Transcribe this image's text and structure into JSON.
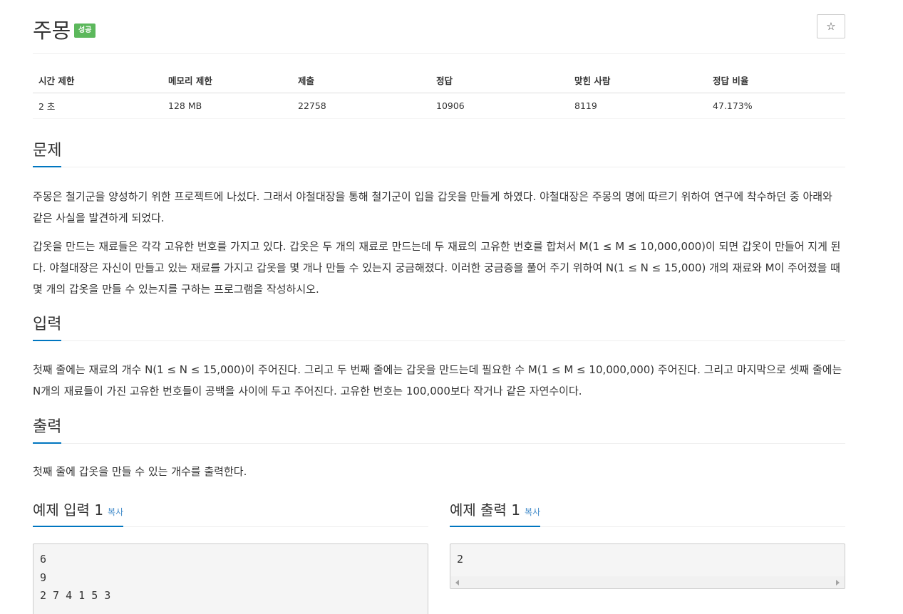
{
  "problem": {
    "title": "주몽",
    "badge": "성공",
    "star_icon": "☆"
  },
  "info_table": {
    "headers": [
      "시간 제한",
      "메모리 제한",
      "제출",
      "정답",
      "맞힌 사람",
      "정답 비율"
    ],
    "values": [
      "2 초",
      "128 MB",
      "22758",
      "10906",
      "8119",
      "47.173%"
    ]
  },
  "sections": {
    "description": {
      "heading": "문제",
      "paragraphs": [
        "주몽은 철기군을 양성하기 위한 프로젝트에 나섰다. 그래서 야철대장을 통해 철기군이 입을 갑옷을 만들게 하였다. 야철대장은 주몽의 명에 따르기 위하여 연구에 착수하던 중 아래와 같은 사실을 발견하게 되었다.",
        "갑옷을 만드는 재료들은 각각 고유한 번호를 가지고 있다. 갑옷은 두 개의 재료로 만드는데 두 재료의 고유한 번호를 합쳐서 M(1 ≤ M ≤ 10,000,000)이 되면 갑옷이 만들어 지게 된다. 야철대장은 자신이 만들고 있는 재료를 가지고 갑옷을 몇 개나 만들 수 있는지 궁금해졌다. 이러한 궁금증을 풀어 주기 위하여 N(1 ≤ N ≤ 15,000) 개의 재료와 M이 주어졌을 때 몇 개의 갑옷을 만들 수 있는지를 구하는 프로그램을 작성하시오."
      ]
    },
    "input": {
      "heading": "입력",
      "text": "첫째 줄에는 재료의 개수 N(1 ≤ N ≤ 15,000)이 주어진다. 그리고 두 번째 줄에는 갑옷을 만드는데 필요한 수 M(1 ≤ M ≤ 10,000,000) 주어진다. 그리고 마지막으로 셋째 줄에는 N개의 재료들이 가진 고유한 번호들이 공백을 사이에 두고 주어진다. 고유한 번호는 100,000보다 작거나 같은 자연수이다."
    },
    "output": {
      "heading": "출력",
      "text": "첫째 줄에 갑옷을 만들 수 있는 개수를 출력한다."
    }
  },
  "examples": {
    "input_1": {
      "heading": "예제 입력 1",
      "copy_label": "복사",
      "content": "6\n9\n2 7 4 1 5 3"
    },
    "output_1": {
      "heading": "예제 출력 1",
      "copy_label": "복사",
      "content": "2"
    }
  },
  "colors": {
    "badge_success": "#5cb85c",
    "section_underline": "#0076c0",
    "copy_link": "#428bca"
  }
}
